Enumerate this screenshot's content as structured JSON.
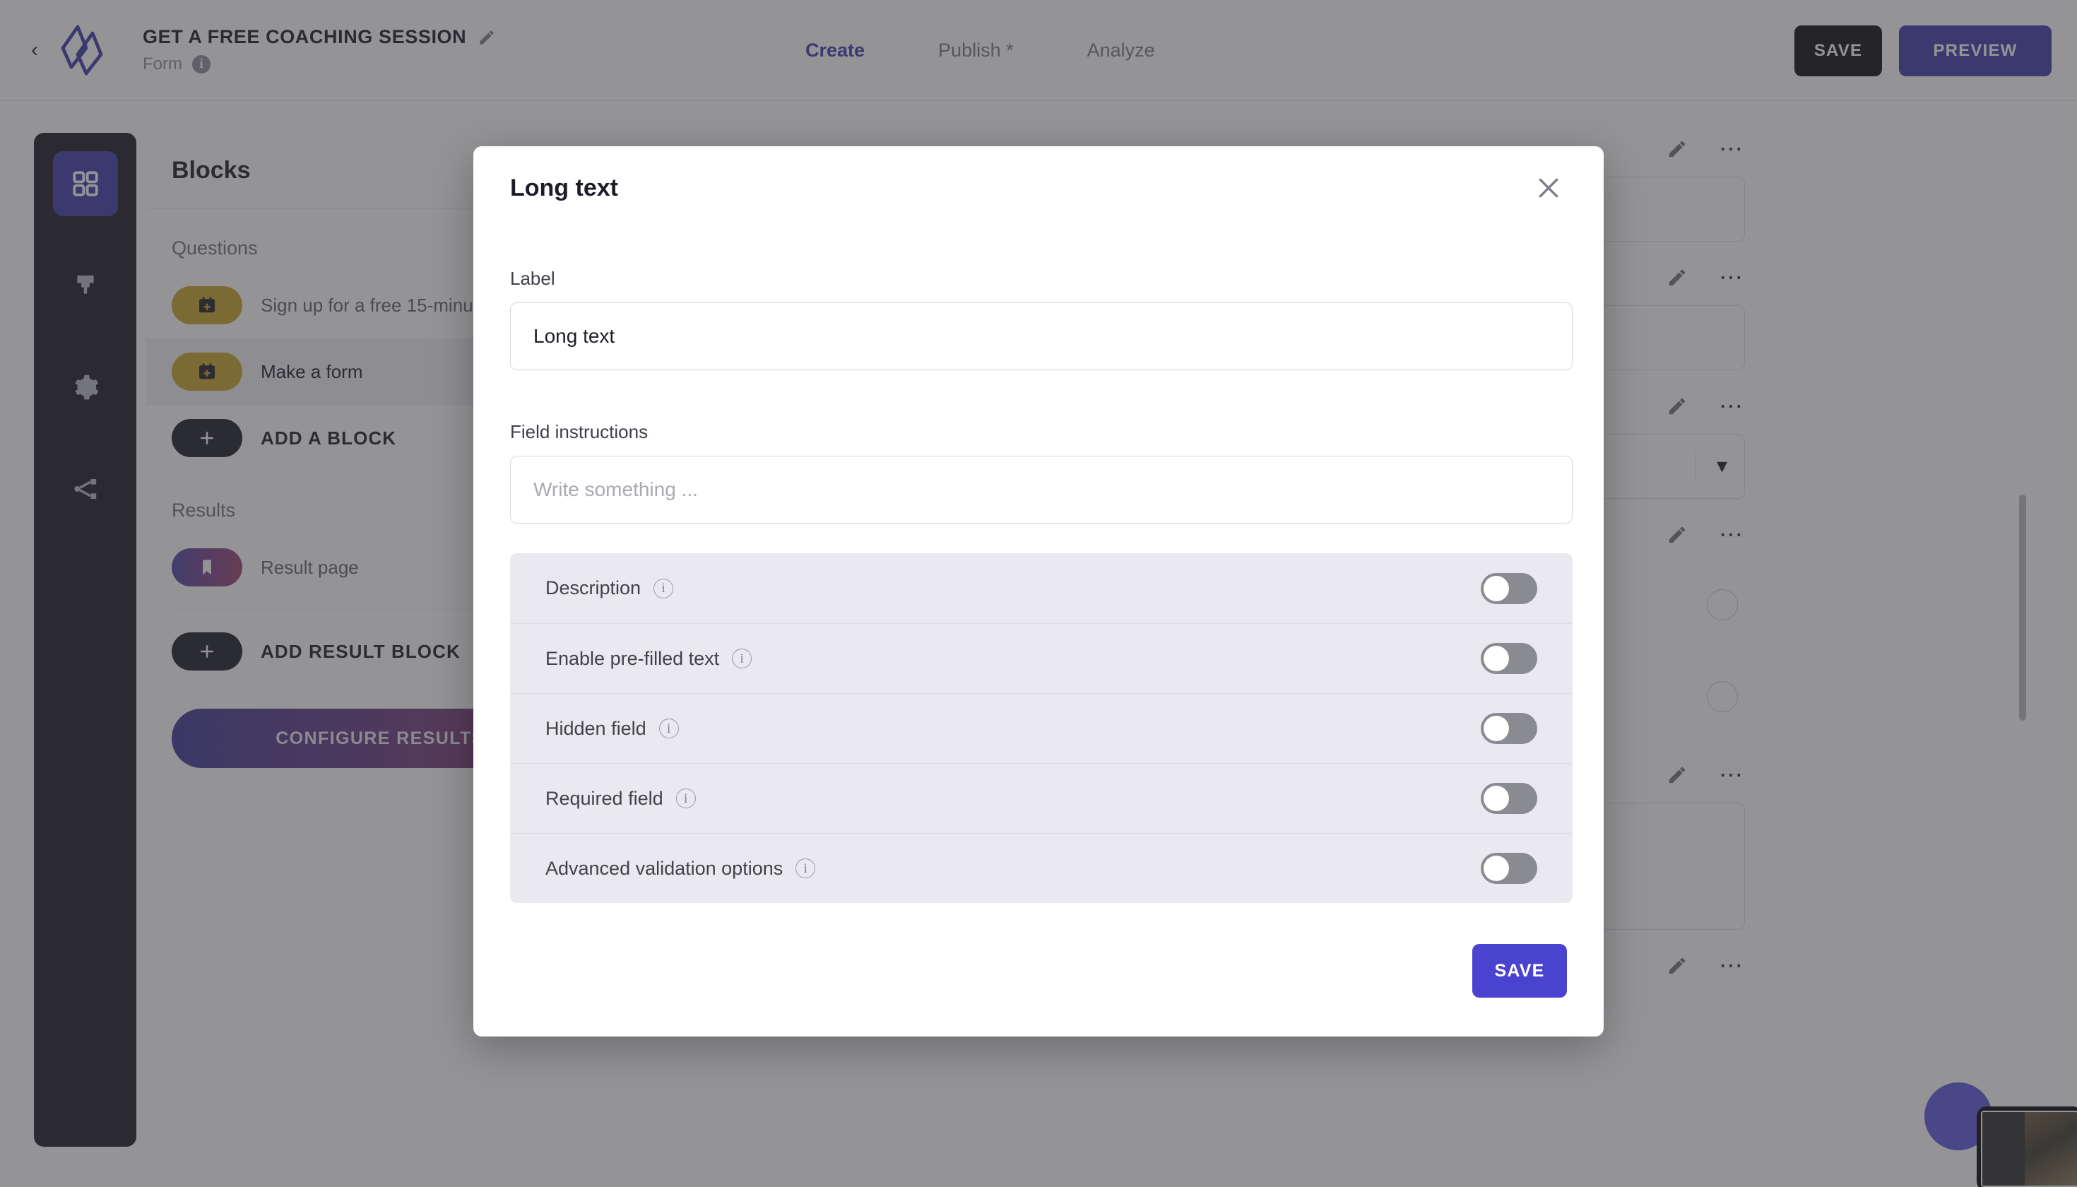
{
  "topbar": {
    "back_icon": "chevron-left-icon",
    "logo_icon": "brand-logo-icon",
    "form_title": "GET A FREE COACHING SESSION",
    "title_edit_icon": "pencil-icon",
    "form_subtype": "Form",
    "subtype_info_icon": "info-icon",
    "tabs": [
      {
        "label": "Create",
        "active": true
      },
      {
        "label": "Publish *",
        "active": false
      },
      {
        "label": "Analyze",
        "active": false
      }
    ],
    "save_label": "SAVE",
    "preview_label": "PREVIEW"
  },
  "rail": {
    "items": [
      {
        "name": "blocks",
        "icon": "grid-icon",
        "active": true
      },
      {
        "name": "design",
        "icon": "paintbrush-icon",
        "active": false
      },
      {
        "name": "settings",
        "icon": "gear-icon",
        "active": false
      },
      {
        "name": "logic",
        "icon": "share-branch-icon",
        "active": false
      }
    ]
  },
  "blocks_panel": {
    "heading": "Blocks",
    "questions_label": "Questions",
    "questions": [
      {
        "label": "Sign up for a free 15-minu",
        "icon": "calendar-plus-icon",
        "selected": false
      },
      {
        "label": "Make a form",
        "icon": "calendar-plus-icon",
        "selected": true
      }
    ],
    "add_block_label": "ADD A BLOCK",
    "add_block_icon": "plus-icon",
    "results_label": "Results",
    "results": [
      {
        "label": "Result page",
        "icon": "bookmark-icon"
      }
    ],
    "add_result_label": "ADD RESULT BLOCK",
    "add_result_icon": "plus-icon",
    "configure_results_label": "CONFIGURE RESULTS"
  },
  "canvas": {
    "row_edit_icon": "pencil-icon",
    "row_menu_icon": "more-dots-icon",
    "dropdown_icon": "chevron-down-icon",
    "calendar_icon": "calendar-icon",
    "scrollbar": "vertical-scrollbar",
    "fab_icon": "chat-bubble-icon",
    "video_widget": "video-preview-widget"
  },
  "modal": {
    "title": "Long text",
    "close_icon": "close-icon",
    "label_field": {
      "label": "Label",
      "value": "Long text",
      "placeholder": ""
    },
    "instructions_field": {
      "label": "Field instructions",
      "value": "",
      "placeholder": "Write something ..."
    },
    "toggles": [
      {
        "label": "Description",
        "info_icon": "info-icon",
        "on": false
      },
      {
        "label": "Enable pre-filled text",
        "info_icon": "info-icon",
        "on": false
      },
      {
        "label": "Hidden field",
        "info_icon": "info-icon",
        "on": false
      },
      {
        "label": "Required field",
        "info_icon": "info-icon",
        "on": false
      },
      {
        "label": "Advanced validation options",
        "info_icon": "info-icon",
        "on": false
      }
    ],
    "save_label": "SAVE"
  },
  "colors": {
    "brand_purple": "#3a36a8",
    "save_modal_purple": "#4a43cf",
    "gold_pill": "#c9a227",
    "dark": "#16161c",
    "toggle_off_track": "#8a8a91",
    "toggle_card_bg": "#e9e9ef"
  }
}
